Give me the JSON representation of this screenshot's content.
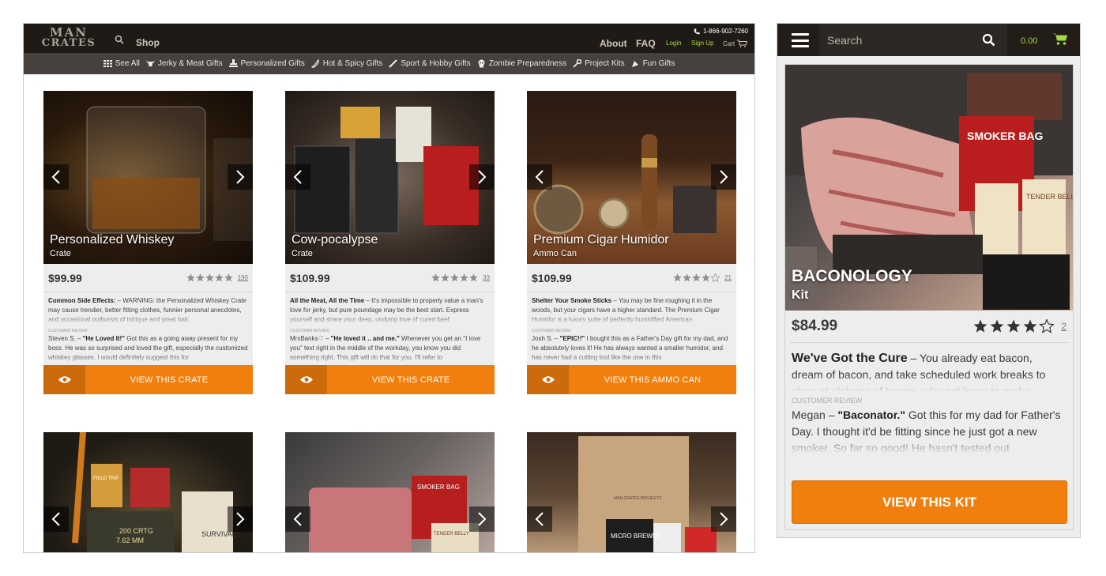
{
  "colors": {
    "accent_orange": "#f07f0e",
    "accent_green": "#a6d640",
    "dark_bar": "#1f1a16",
    "category_bar": "#46413d"
  },
  "desktop": {
    "logo": {
      "line1": "MAN",
      "line2": "CRATES"
    },
    "shop_label": "Shop",
    "phone": "1-866-902-7260",
    "about_label": "About",
    "faq_label": "FAQ",
    "login_label": "Login",
    "signup_label": "Sign Up",
    "cart_label": "Cart",
    "categories": [
      {
        "label": "See All",
        "icon": "grid-icon"
      },
      {
        "label": "Jerky & Meat Gifts",
        "icon": "bull-icon"
      },
      {
        "label": "Personalized Gifts",
        "icon": "stamp-icon"
      },
      {
        "label": "Hot & Spicy Gifts",
        "icon": "pepper-icon"
      },
      {
        "label": "Sport & Hobby Gifts",
        "icon": "bat-icon"
      },
      {
        "label": "Zombie Preparedness",
        "icon": "skull-icon"
      },
      {
        "label": "Project Kits",
        "icon": "wrench-icon"
      },
      {
        "label": "Fun Gifts",
        "icon": "party-icon"
      }
    ],
    "products": [
      {
        "name": "Personalized Whiskey",
        "type": "Crate",
        "price": "$99.99",
        "rating": 5,
        "reviews": "190",
        "desc_title": "Common Side Effects:",
        "desc_text": " – WARNING: the Personalized Whiskey Crate may cause trendier, better fitting clothes, funnier personal anecdotes, and occasional outbursts of intrigue and great hair.",
        "review_label": "CUSTOMER REVIEW",
        "reviewer": "Steven S.",
        "review_title": "\"He Loved It!\"",
        "review_text": " Got this as a going away present for my boss. He was so surprised and loved the gift, especially the customized whiskey glasses. I would definitely suggest this for",
        "button": "VIEW THIS CRATE"
      },
      {
        "name": "Cow-pocalypse",
        "type": "Crate",
        "price": "$109.99",
        "rating": 5,
        "reviews": "33",
        "desc_title": "All the Meat, All the Time",
        "desc_text": " – It's impossible to properly value a man's love for jerky, but pure poundage may be the best start. Express yourself and share your deep, undying love of cured beef",
        "review_label": "CUSTOMER REVIEW",
        "reviewer": "MrsBanks♡",
        "review_title": "\"He loved it .. and me.\"",
        "review_text": " Whenever you get an \"I love you\" text right in the middle of the workday, you know you did something right. This gift will do that for you. I'll refer to",
        "button": "VIEW THIS CRATE"
      },
      {
        "name": "Premium Cigar Humidor",
        "type": "Ammo Can",
        "price": "$109.99",
        "rating": 4.5,
        "reviews": "21",
        "desc_title": "Shelter Your Smoke Sticks",
        "desc_text": " – You may be fine roughing it in the woods, but your cigars have a higher standard. The Premium Cigar Humidor is a luxury suite of perfectly humidified American",
        "review_label": "CUSTOMER REVIEW",
        "reviewer": "Josh S.",
        "review_title": "\"EPIC!!\"",
        "review_text": " I bought this as a Father's Day gift for my dad, and he absolutely loves it! He has always wanted a smaller humidor, and has never had a cutting tool like the one in this",
        "button": "VIEW THIS AMMO CAN"
      }
    ],
    "bottom_row_images": [
      {
        "text_1": "FIELD TRIP",
        "text_2": "200 CRTG",
        "text_3": "7.62 MM",
        "text_4": "SURVIVAL"
      },
      {
        "text_1": "SMOKER BAG",
        "text_2": "TENDER BELLY"
      },
      {
        "text_1": "MICRO BREWED",
        "text_2": "MAN CRATES PROJECTS"
      }
    ]
  },
  "mobile": {
    "search_placeholder": "Search",
    "cart_total": "0.00",
    "product": {
      "name": "BACONOLOGY",
      "type": "Kit",
      "price": "$84.99",
      "rating": 4.5,
      "reviews": "2",
      "image_label_1": "SMOKER BAG",
      "image_label_2": "TENDER BELLY",
      "desc_title": "We've Got the Cure",
      "desc_text": " – You already eat bacon, dream of bacon, and take scheduled work breaks to stare at pictures of bacon, why not learn to make",
      "review_label": "CUSTOMER REVIEW",
      "reviewer": "Megan",
      "review_title": "\"Baconator.\"",
      "review_text": " Got this for my dad for Father's Day. I thought it'd be fitting since he just got a new smoker. So far so good! He hasn't tested out",
      "button": "VIEW THIS KIT"
    }
  }
}
